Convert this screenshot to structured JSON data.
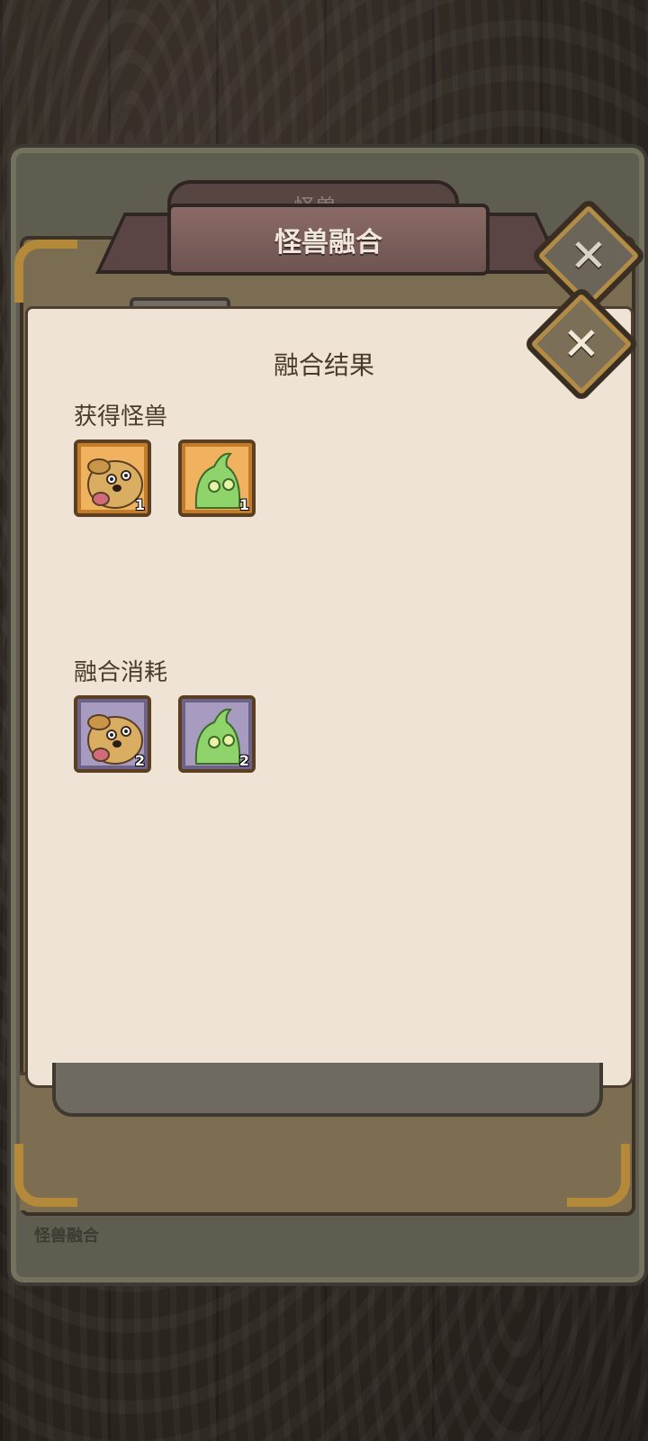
{
  "background_panel": {
    "label": "怪兽融合",
    "title_faded": "怪兽"
  },
  "dialog": {
    "title": "怪兽融合",
    "subtitle": "融合结果",
    "close_icon": "close-icon",
    "obtained": {
      "label": "获得怪兽",
      "items": [
        {
          "monster": "dog-monster",
          "rarity": "gold",
          "count": "1"
        },
        {
          "monster": "green-blob-monster",
          "rarity": "gold",
          "count": "1"
        }
      ]
    },
    "consumed": {
      "label": "融合消耗",
      "items": [
        {
          "monster": "dog-monster",
          "rarity": "purple",
          "count": "2"
        },
        {
          "monster": "green-blob-monster",
          "rarity": "purple",
          "count": "2"
        }
      ]
    }
  },
  "colors": {
    "paper": "#efe3d5",
    "ribbon": "#7a5e5a",
    "gold_frame": "#e1a44e",
    "purple_frame": "#9d92b6",
    "text_dark": "#4a3a2e"
  }
}
